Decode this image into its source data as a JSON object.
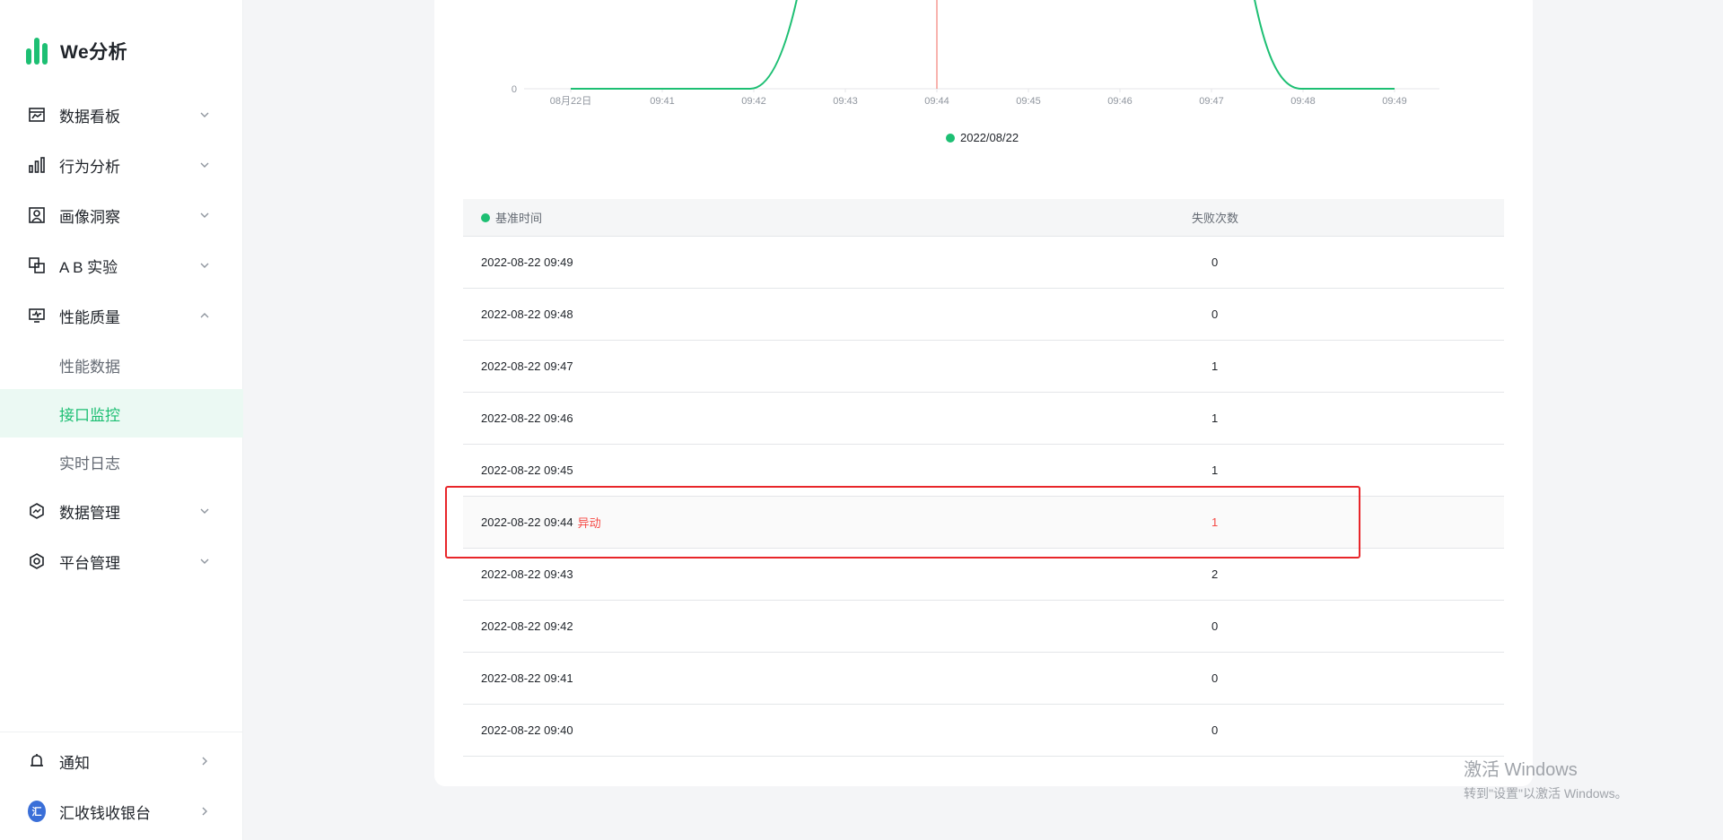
{
  "app": {
    "logo_text": "We分析"
  },
  "sidebar": {
    "items": [
      {
        "label": "数据看板",
        "icon": "dashboard-icon"
      },
      {
        "label": "行为分析",
        "icon": "bar-chart-icon"
      },
      {
        "label": "画像洞察",
        "icon": "portrait-icon"
      },
      {
        "label": "A B 实验",
        "icon": "ab-test-icon"
      },
      {
        "label": "性能质量",
        "icon": "monitor-icon",
        "expanded": true
      }
    ],
    "sub_items": [
      {
        "label": "性能数据"
      },
      {
        "label": "接口监控",
        "active": true
      },
      {
        "label": "实时日志"
      }
    ],
    "items_after": [
      {
        "label": "数据管理",
        "icon": "data-manage-icon"
      },
      {
        "label": "平台管理",
        "icon": "settings-hex-icon"
      }
    ],
    "bottom": [
      {
        "label": "通知",
        "icon": "bell-icon"
      },
      {
        "label": "汇收钱收银台",
        "icon": "account-avatar-icon",
        "avatar_text": "汇"
      }
    ]
  },
  "chart_data": {
    "type": "line",
    "categories": [
      "08月22日",
      "09:41",
      "09:42",
      "09:43",
      "09:44",
      "09:45",
      "09:46",
      "09:47",
      "09:48",
      "09:49"
    ],
    "series": [
      {
        "name": "2022/08/22",
        "color": "#1dbf73"
      }
    ],
    "y_tick_labels": [
      "0"
    ],
    "marker_line_at": "09:44",
    "marker_color": "#f0675c"
  },
  "table": {
    "headers": {
      "time": "基准时间",
      "failures": "失败次数"
    },
    "rows": [
      {
        "time": "2022-08-22 09:49",
        "count": "0"
      },
      {
        "time": "2022-08-22 09:48",
        "count": "0"
      },
      {
        "time": "2022-08-22 09:47",
        "count": "1"
      },
      {
        "time": "2022-08-22 09:46",
        "count": "1"
      },
      {
        "time": "2022-08-22 09:45",
        "count": "1"
      },
      {
        "time": "2022-08-22 09:44",
        "count": "1",
        "tag": "异动"
      },
      {
        "time": "2022-08-22 09:43",
        "count": "2"
      },
      {
        "time": "2022-08-22 09:42",
        "count": "0"
      },
      {
        "time": "2022-08-22 09:41",
        "count": "0"
      },
      {
        "time": "2022-08-22 09:40",
        "count": "0"
      }
    ]
  },
  "watermark": {
    "line1": "激活 Windows",
    "line2": "转到\"设置\"以激活 Windows。"
  }
}
